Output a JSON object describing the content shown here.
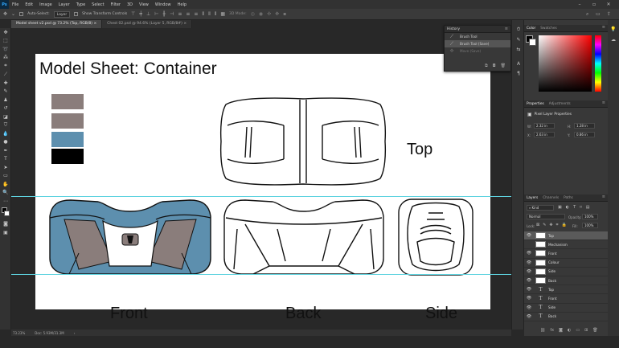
{
  "menubar": {
    "app_logo": "Ps",
    "items": [
      "File",
      "Edit",
      "Image",
      "Layer",
      "Type",
      "Select",
      "Filter",
      "3D",
      "View",
      "Window",
      "Help"
    ]
  },
  "options_bar": {
    "auto_select_label": "Auto-Select:",
    "auto_select_value": "Layer",
    "show_transform_label": "Show Transform Controls",
    "mode_3d_label": "3D Mode:"
  },
  "tabs": [
    {
      "label": "Model sheet v2.psd @ 73.2% (Top, RGB/8)",
      "active": true
    },
    {
      "label": "Chest 02.psd @ 94.6% (Layer 5, RGB/8#)",
      "active": false
    }
  ],
  "document": {
    "title": "Model Sheet: Container",
    "swatch_colors": [
      "#8a7d7b",
      "#8a7d7b",
      "#5d8fae",
      "#000000"
    ],
    "view_labels": {
      "top": "Top",
      "front": "Front",
      "back": "Back",
      "side": "Side"
    },
    "accent_blue": "#5d8fae",
    "accent_gray": "#8a7d7b",
    "guide_color": "#5fd3e0"
  },
  "status": {
    "zoom": "73.23%",
    "doc_size": "Doc: 5.93M/31.3M"
  },
  "history_panel": {
    "tab_title": "History",
    "items": [
      {
        "label": "Brush Tool",
        "state": "normal"
      },
      {
        "label": "Brush Tool (Save)",
        "state": "selected"
      },
      {
        "label": "Move (Save)",
        "state": "dim"
      }
    ]
  },
  "color_panel": {
    "tabs": [
      "Color",
      "Swatches"
    ]
  },
  "properties_panel": {
    "tabs": [
      "Properties",
      "Adjustments"
    ],
    "section_label": "Pixel Layer Properties",
    "fields": {
      "W": "2.32 in",
      "H": "1.28 in",
      "X": "2.63 in",
      "Y": "0.86 in"
    }
  },
  "layers_panel": {
    "tabs": [
      "Layers",
      "Channels",
      "Paths"
    ],
    "filter_kind": "Kind",
    "blend_mode": "Normal",
    "opacity_label": "Opacity:",
    "opacity_value": "100%",
    "lock_label": "Lock:",
    "fill_label": "Fill:",
    "fill_value": "100%",
    "layers": [
      {
        "name": "Top",
        "kind": "pixel",
        "selected": true
      },
      {
        "name": "Mechanism",
        "kind": "pixel",
        "selected": false
      },
      {
        "name": "Front",
        "kind": "pixel",
        "selected": false
      },
      {
        "name": "Colour",
        "kind": "pixel",
        "selected": false
      },
      {
        "name": "Side",
        "kind": "pixel",
        "selected": false
      },
      {
        "name": "Back",
        "kind": "pixel",
        "selected": false
      },
      {
        "name": "Top",
        "kind": "text",
        "selected": false
      },
      {
        "name": "Front",
        "kind": "text",
        "selected": false
      },
      {
        "name": "Side",
        "kind": "text",
        "selected": false
      },
      {
        "name": "Back",
        "kind": "text",
        "selected": false
      }
    ]
  }
}
